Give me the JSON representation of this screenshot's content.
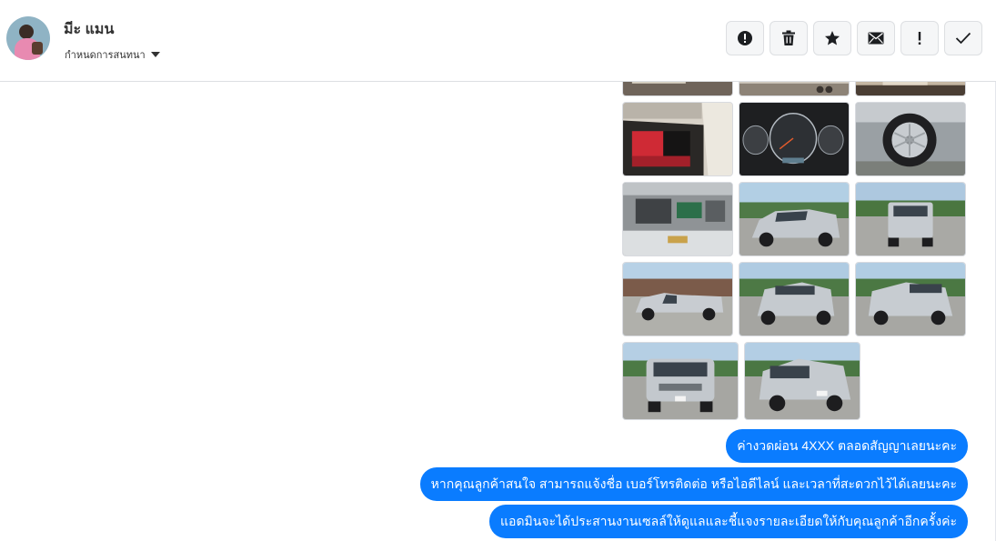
{
  "header": {
    "contact_name": "มีะ แมน",
    "subtitle": "กำหนดการสนทนา"
  },
  "toolbar": {
    "buttons": [
      {
        "icon": "alert-circle-icon",
        "name": "report-button"
      },
      {
        "icon": "trash-icon",
        "name": "delete-button"
      },
      {
        "icon": "star-icon",
        "name": "star-button"
      },
      {
        "icon": "mail-icon",
        "name": "mark-unread-button"
      },
      {
        "icon": "exclamation-icon",
        "name": "important-button"
      },
      {
        "icon": "check-icon",
        "name": "done-button"
      }
    ]
  },
  "messages": [
    {
      "text": "ค่างวดผ่อน 4XXX ตลอดสัญญาเลยนะคะ"
    },
    {
      "text": "หากคุณลูกค้าสนใจ สามารถแจ้งชื่อ เบอร์โทรติดต่อ หรือไอดีไลน์ และเวลาที่สะดวกไว้ได้เลยนะคะ"
    },
    {
      "text": "แอดมินจะได้ประสานงานเซลล์ให้ดูแลและชี้แจงรายละเอียดให้กับคุณลูกค้าอีกครั้งค่ะ"
    }
  ],
  "photos": [
    {
      "subject": "car-interior-top-1"
    },
    {
      "subject": "car-interior-top-2"
    },
    {
      "subject": "car-interior-top-3"
    },
    {
      "subject": "car-rear-seat"
    },
    {
      "subject": "car-dashboard-gauges"
    },
    {
      "subject": "car-wheel"
    },
    {
      "subject": "car-engine-bay"
    },
    {
      "subject": "pickup-front-left"
    },
    {
      "subject": "pickup-rear"
    },
    {
      "subject": "pickup-side"
    },
    {
      "subject": "pickup-rear-left"
    },
    {
      "subject": "pickup-rear-right"
    },
    {
      "subject": "pickup-front"
    },
    {
      "subject": "pickup-front-right"
    }
  ]
}
